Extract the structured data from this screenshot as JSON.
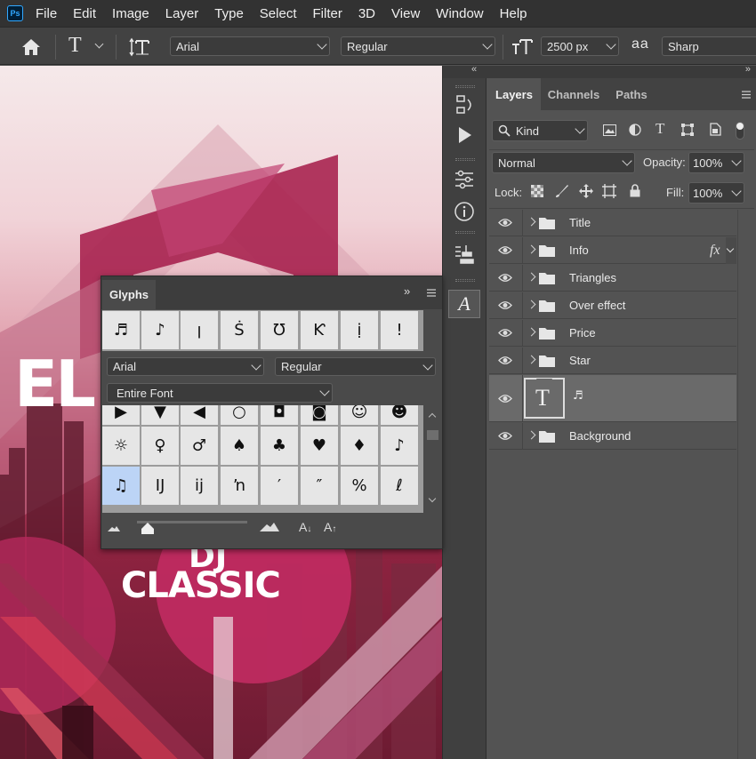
{
  "menu": [
    "File",
    "Edit",
    "Image",
    "Layer",
    "Type",
    "Select",
    "Filter",
    "3D",
    "View",
    "Window",
    "Help"
  ],
  "app_logo": "Ps",
  "options": {
    "font_family": "Arial",
    "font_style": "Regular",
    "font_size": "2500 px",
    "antialias_icon": "aa",
    "antialias": "Sharp"
  },
  "canvas": {
    "text_el": "EL",
    "text_dj": "DJ",
    "text_classic": "CLASSIC"
  },
  "layers_panel": {
    "tabs": [
      "Layers",
      "Channels",
      "Paths"
    ],
    "filter_kind": "Kind",
    "blend_mode": "Normal",
    "opacity_label": "Opacity:",
    "opacity": "100%",
    "lock_label": "Lock:",
    "fill_label": "Fill:",
    "fill": "100%",
    "layers": [
      {
        "name": "Title",
        "type": "group"
      },
      {
        "name": "Info",
        "type": "group",
        "fx": "fx"
      },
      {
        "name": "Triangles",
        "type": "group"
      },
      {
        "name": "Over effect",
        "type": "group"
      },
      {
        "name": "Price",
        "type": "group"
      },
      {
        "name": "Star",
        "type": "group"
      },
      {
        "name": "♬",
        "type": "text",
        "thumb": "T"
      },
      {
        "name": "Background",
        "type": "group"
      }
    ]
  },
  "glyphs_panel": {
    "title": "Glyphs",
    "recent": [
      "♬",
      "♪",
      "ꞁ",
      "Ṡ",
      "Ʊ",
      "Ƙ",
      "ị",
      "ǃ"
    ],
    "font_family": "Arial",
    "font_style": "Regular",
    "subset": "Entire Font",
    "grid": [
      [
        "▶",
        "▼",
        "◀",
        "○",
        "◘",
        "◙",
        "☺",
        "☻"
      ],
      [
        "☼",
        "♀",
        "♂",
        "♠",
        "♣",
        "♥",
        "♦",
        "♪"
      ],
      [
        "♫",
        "Ĳ",
        "ĳ",
        "ŉ",
        "′",
        "″",
        "%",
        "ℓ"
      ]
    ],
    "selected_glyph": "♫"
  },
  "colors": {
    "menubar": "#323232",
    "options_bar": "#424242",
    "panel": "#535353",
    "selected_glyph": "#bcd4f6"
  }
}
